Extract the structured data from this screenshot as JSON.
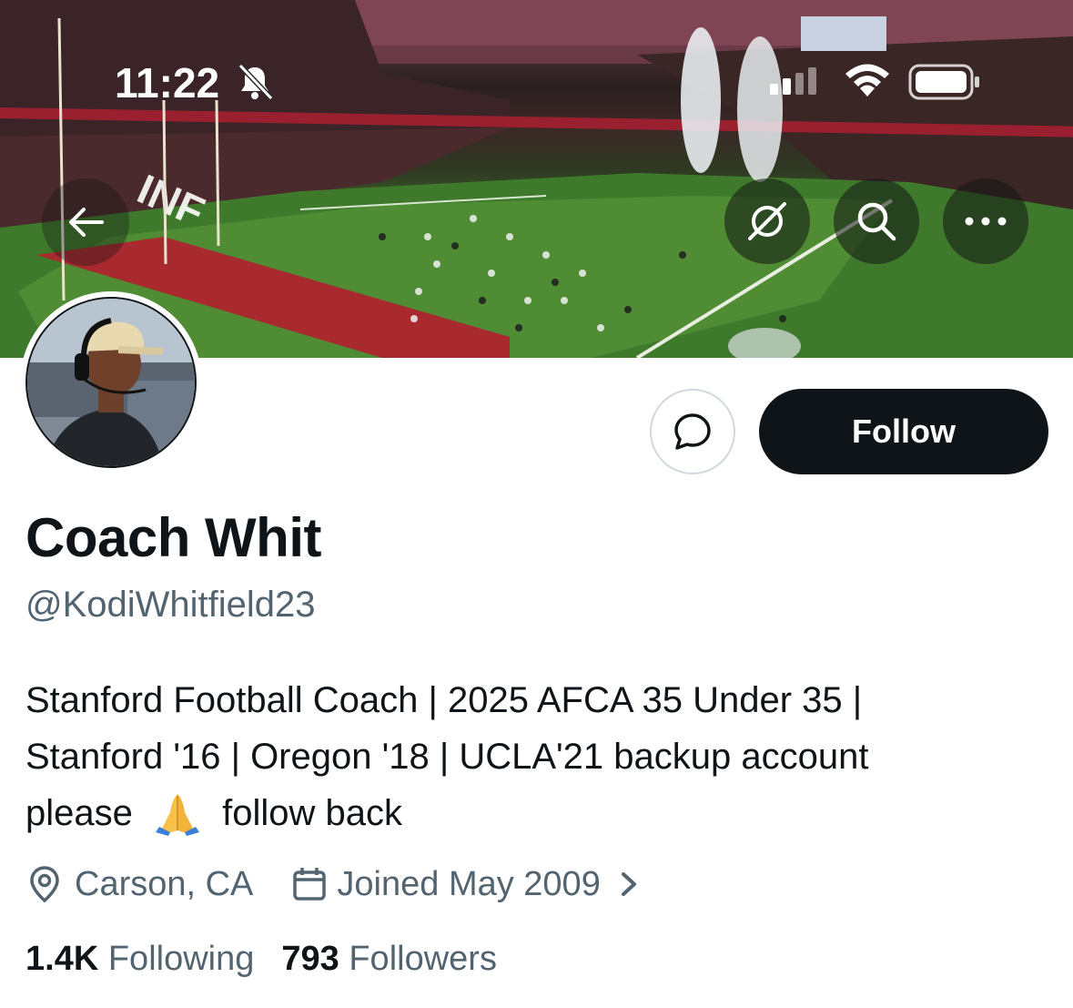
{
  "status_bar": {
    "time": "11:22"
  },
  "profile": {
    "display_name": "Coach Whit",
    "handle": "@KodiWhitfield23",
    "bio_line1": "Stanford Football Coach | 2025 AFCA 35 Under 35 |",
    "bio_line2": "Stanford '16 | Oregon '18 | UCLA'21 backup account",
    "bio_line3_before": "please",
    "bio_line3_after": "follow back",
    "location": "Carson, CA",
    "joined": "Joined May 2009",
    "following_count": "1.4K",
    "following_label": "Following",
    "followers_count": "793",
    "followers_label": "Followers"
  },
  "actions": {
    "follow_label": "Follow"
  },
  "icons": {
    "back": "arrow-left-icon",
    "grok": "grok-icon",
    "search": "search-icon",
    "more": "more-horizontal-icon",
    "message": "message-bubble-icon",
    "location": "location-pin-icon",
    "calendar": "calendar-icon",
    "bio_emoji": "folded-hands-emoji"
  },
  "colors": {
    "text_primary": "#0f1419",
    "text_secondary": "#536471",
    "follow_bg": "#0f1419",
    "border": "#cfd9de"
  }
}
